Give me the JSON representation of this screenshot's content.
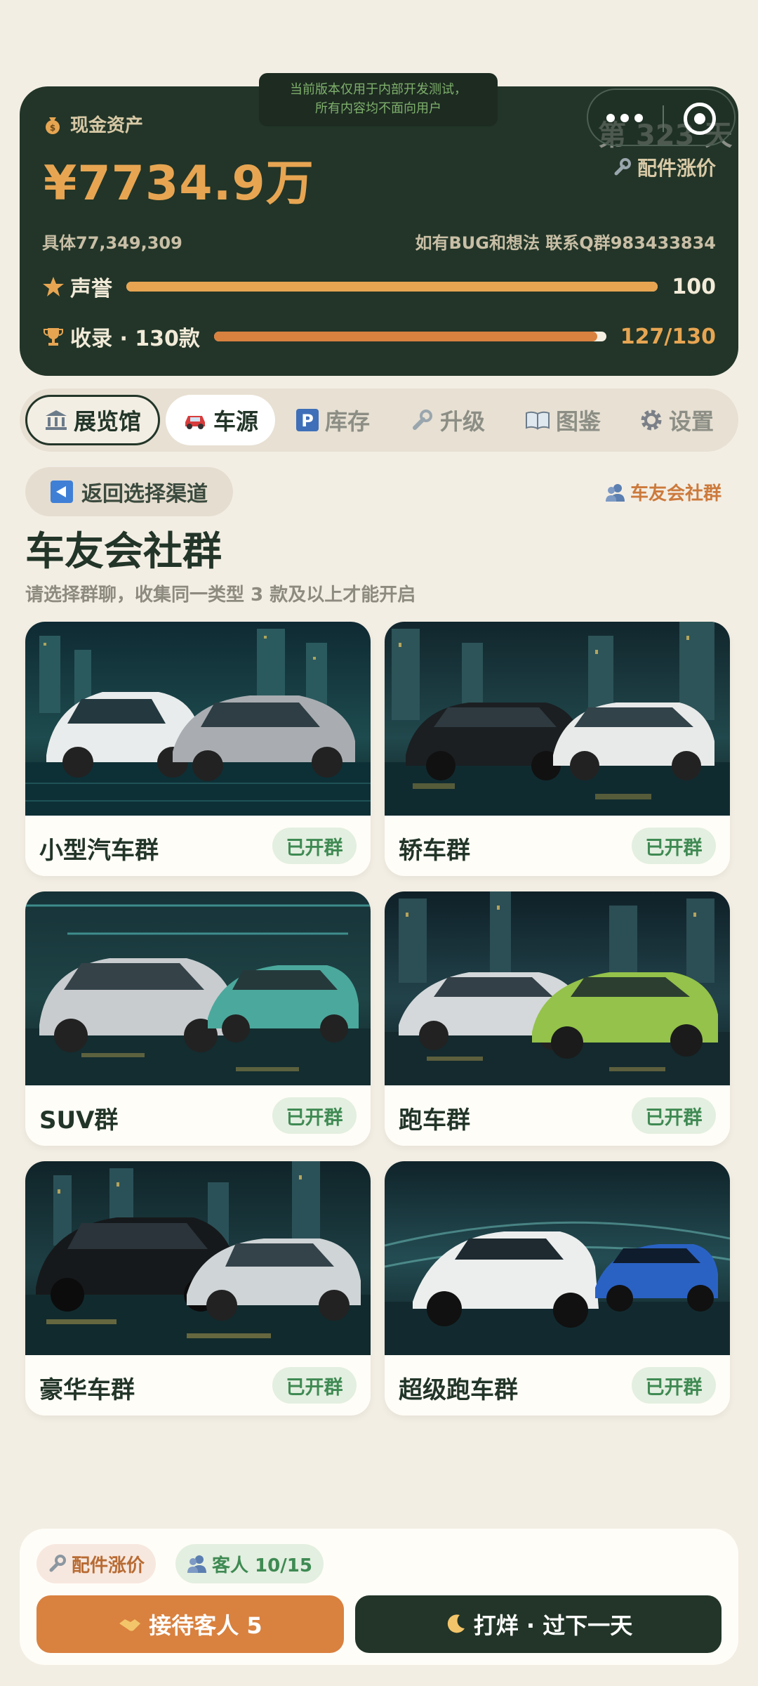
{
  "stats": {
    "cash_label": "现金资产",
    "cash_value": "¥7734.9万",
    "exact": "具体77,349,309",
    "contact": "如有BUG和想法 联系Q群983433834",
    "dev_banner_line1": "当前版本仅用于内部开发测试，",
    "dev_banner_line2": "所有内容均不面向用户",
    "day": "第 323 天",
    "parts_link": "配件涨价",
    "reputation_label": "声誉",
    "reputation_value": "100",
    "reputation_fraction": 1.0,
    "collection_label": "收录 · 130款",
    "collection_value": "127/130",
    "collection_fraction": 0.977
  },
  "tabs": [
    {
      "label": "展览馆",
      "icon": "museum-icon"
    },
    {
      "label": "车源",
      "icon": "car-icon"
    },
    {
      "label": "库存",
      "icon": "parking-icon"
    },
    {
      "label": "升级",
      "icon": "wrench-icon"
    },
    {
      "label": "图鉴",
      "icon": "book-icon"
    },
    {
      "label": "设置",
      "icon": "gear-icon"
    }
  ],
  "nav": {
    "back_label": "返回选择渠道",
    "community_link": "车友会社群",
    "title": "车友会社群",
    "subtitle": "请选择群聊，收集同一类型 3 款及以上才能开启"
  },
  "groups": [
    {
      "name": "小型汽车群",
      "badge": "已开群"
    },
    {
      "name": "轿车群",
      "badge": "已开群"
    },
    {
      "name": "SUV群",
      "badge": "已开群"
    },
    {
      "name": "跑车群",
      "badge": "已开群"
    },
    {
      "name": "豪华车群",
      "badge": "已开群"
    },
    {
      "name": "超级跑车群",
      "badge": "已开群"
    }
  ],
  "bottom": {
    "parts_chip": "配件涨价",
    "guest_chip": "客人 10/15",
    "receive_button": "接待客人 5",
    "close_button": "打烊 · 过下一天"
  },
  "colors": {
    "bg": "#f3eee4",
    "dark_green": "#223528",
    "gold": "#e7a552",
    "orange": "#d9813f",
    "badge_green": "#3f8a53"
  }
}
